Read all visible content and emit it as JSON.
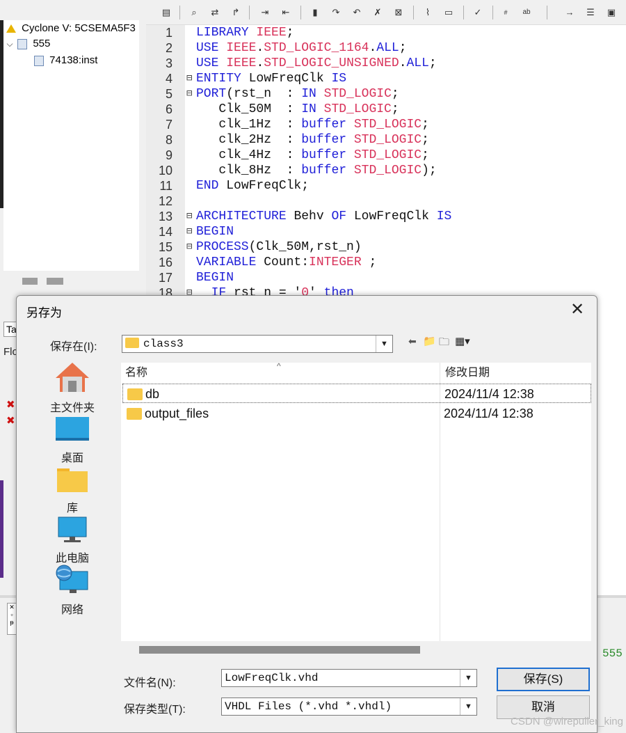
{
  "hierarchy": {
    "device": "Cyclone V: 5CSEMA5F3",
    "top": "555",
    "instance": "74138:inst"
  },
  "left_panel": {
    "tab_label": "Ta",
    "flow_label": "Flo"
  },
  "editor": {
    "lines": [
      {
        "n": "1",
        "fold": "",
        "parts": [
          [
            "kw",
            "LIBRARY "
          ],
          [
            "ty",
            "IEEE"
          ],
          [
            "tx",
            ";"
          ]
        ]
      },
      {
        "n": "2",
        "fold": "",
        "parts": [
          [
            "kw",
            "USE "
          ],
          [
            "ty",
            "IEEE"
          ],
          [
            "tx",
            "."
          ],
          [
            "ty",
            "STD_LOGIC_1164"
          ],
          [
            "tx",
            "."
          ],
          [
            "kw",
            "ALL"
          ],
          [
            "tx",
            ";"
          ]
        ]
      },
      {
        "n": "3",
        "fold": "",
        "parts": [
          [
            "kw",
            "USE "
          ],
          [
            "ty",
            "IEEE"
          ],
          [
            "tx",
            "."
          ],
          [
            "ty",
            "STD_LOGIC_UNSIGNED"
          ],
          [
            "tx",
            "."
          ],
          [
            "kw",
            "ALL"
          ],
          [
            "tx",
            ";"
          ]
        ]
      },
      {
        "n": "4",
        "fold": "⊟",
        "parts": [
          [
            "kw",
            "ENTITY "
          ],
          [
            "tx",
            "LowFreqClk "
          ],
          [
            "kw",
            "IS"
          ]
        ]
      },
      {
        "n": "5",
        "fold": "⊟",
        "parts": [
          [
            "kw",
            "PORT"
          ],
          [
            "tx",
            "(rst_n  : "
          ],
          [
            "kw",
            "IN "
          ],
          [
            "ty",
            "STD_LOGIC"
          ],
          [
            "tx",
            ";"
          ]
        ]
      },
      {
        "n": "6",
        "fold": "",
        "parts": [
          [
            "tx",
            "   Clk_50M  : "
          ],
          [
            "kw",
            "IN "
          ],
          [
            "ty",
            "STD_LOGIC"
          ],
          [
            "tx",
            ";"
          ]
        ]
      },
      {
        "n": "7",
        "fold": "",
        "parts": [
          [
            "tx",
            "   clk_1Hz  : "
          ],
          [
            "kw",
            "buffer "
          ],
          [
            "ty",
            "STD_LOGIC"
          ],
          [
            "tx",
            ";"
          ]
        ]
      },
      {
        "n": "8",
        "fold": "",
        "parts": [
          [
            "tx",
            "   clk_2Hz  : "
          ],
          [
            "kw",
            "buffer "
          ],
          [
            "ty",
            "STD_LOGIC"
          ],
          [
            "tx",
            ";"
          ]
        ]
      },
      {
        "n": "9",
        "fold": "",
        "parts": [
          [
            "tx",
            "   clk_4Hz  : "
          ],
          [
            "kw",
            "buffer "
          ],
          [
            "ty",
            "STD_LOGIC"
          ],
          [
            "tx",
            ";"
          ]
        ]
      },
      {
        "n": "10",
        "fold": "",
        "parts": [
          [
            "tx",
            "   clk_8Hz  : "
          ],
          [
            "kw",
            "buffer "
          ],
          [
            "ty",
            "STD_LOGIC"
          ],
          [
            "tx",
            ");"
          ]
        ]
      },
      {
        "n": "11",
        "fold": "",
        "parts": [
          [
            "kw",
            "END "
          ],
          [
            "tx",
            "LowFreqClk;"
          ]
        ]
      },
      {
        "n": "12",
        "fold": "",
        "parts": []
      },
      {
        "n": "13",
        "fold": "⊟",
        "parts": [
          [
            "kw",
            "ARCHITECTURE "
          ],
          [
            "tx",
            "Behv "
          ],
          [
            "kw",
            "OF "
          ],
          [
            "tx",
            "LowFreqClk "
          ],
          [
            "kw",
            "IS"
          ]
        ]
      },
      {
        "n": "14",
        "fold": "⊟",
        "parts": [
          [
            "kw",
            "BEGIN"
          ]
        ]
      },
      {
        "n": "15",
        "fold": "⊟",
        "parts": [
          [
            "kw",
            "PROCESS"
          ],
          [
            "tx",
            "(Clk_50M,rst_n)"
          ]
        ]
      },
      {
        "n": "16",
        "fold": "",
        "parts": [
          [
            "kw",
            "VARIABLE "
          ],
          [
            "tx",
            "Count:"
          ],
          [
            "ty",
            "INTEGER"
          ],
          [
            "tx",
            " ;"
          ]
        ]
      },
      {
        "n": "17",
        "fold": "",
        "parts": [
          [
            "kw",
            "BEGIN"
          ]
        ]
      },
      {
        "n": "18",
        "fold": "⊟",
        "parts": [
          [
            "tx",
            "  "
          ],
          [
            "kw",
            "IF "
          ],
          [
            "tx",
            "rst_n = '"
          ],
          [
            "ty",
            "0"
          ],
          [
            "tx",
            "' "
          ],
          [
            "kw",
            "then"
          ]
        ]
      }
    ],
    "output_snippet": "555"
  },
  "dialog": {
    "title": "另存为",
    "save_in_label": "保存在(I):",
    "save_in_value": "class3",
    "places": [
      {
        "label": "主文件夹",
        "icon": "home-icon"
      },
      {
        "label": "桌面",
        "icon": "desktop-icon"
      },
      {
        "label": "库",
        "icon": "library-icon"
      },
      {
        "label": "此电脑",
        "icon": "computer-icon"
      },
      {
        "label": "网络",
        "icon": "network-icon"
      }
    ],
    "columns": {
      "name": "名称",
      "modified": "修改日期"
    },
    "files": [
      {
        "name": "db",
        "modified": "2024/11/4 12:38"
      },
      {
        "name": "output_files",
        "modified": "2024/11/4 12:38"
      }
    ],
    "filename_label": "文件名(N):",
    "filename_value": "LowFreqClk.vhd",
    "filetype_label": "保存类型(T):",
    "filetype_value": "VHDL Files (*.vhd *.vhdl)",
    "save_button": "保存(S)",
    "cancel_button": "取消"
  },
  "watermark": "CSDN @wirepuller_king"
}
